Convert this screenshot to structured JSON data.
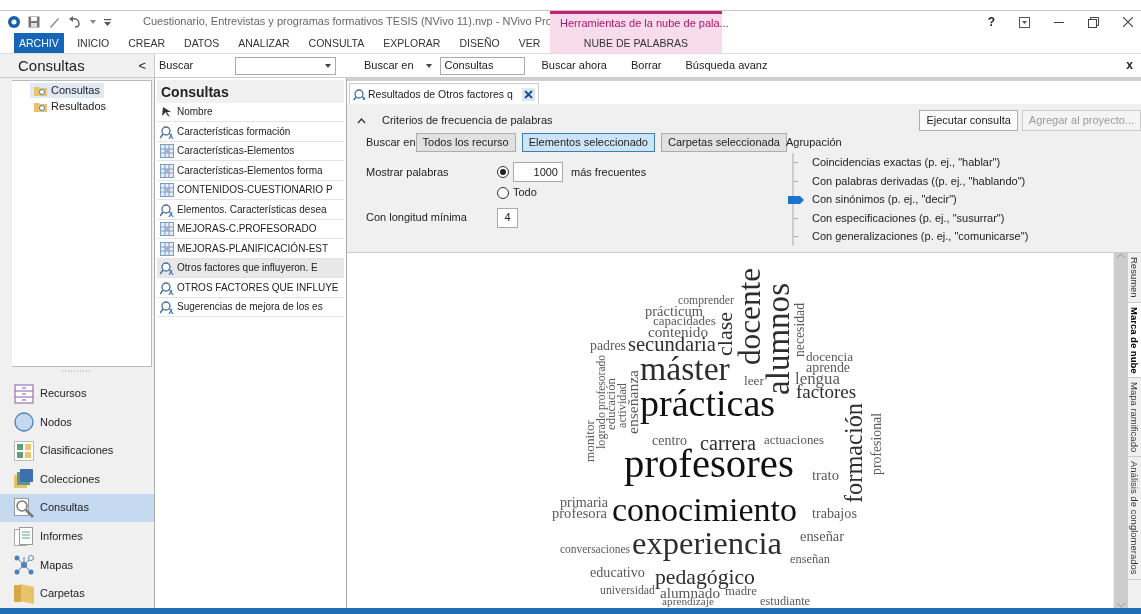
{
  "title_bar": {
    "title": "Cuestionario, Entrevistas y programas formativos TESIS (NVivo 11).nvp - NVivo Pro",
    "context_group": "Herramientas de la nube de pala...",
    "help": "?"
  },
  "ribbon_tabs": [
    {
      "label": "ARCHIV",
      "kind": "file"
    },
    {
      "label": "INICIO",
      "kind": "tab"
    },
    {
      "label": "CREAR",
      "kind": "tab"
    },
    {
      "label": "DATOS",
      "kind": "tab"
    },
    {
      "label": "ANALIZAR",
      "kind": "tab"
    },
    {
      "label": "CONSULTA",
      "kind": "tab"
    },
    {
      "label": "EXPLORAR",
      "kind": "tab"
    },
    {
      "label": "DISEÑO",
      "kind": "tab"
    },
    {
      "label": "VER",
      "kind": "tab"
    },
    {
      "label": "NUBE DE PALABRAS",
      "kind": "contextual"
    }
  ],
  "find_bar": {
    "pane_title": "Consultas",
    "collapse": "<",
    "find_label": "Buscar",
    "search_in_label": "Buscar en",
    "search_in_value": "Consultas",
    "buttons": [
      "Buscar ahora",
      "Borrar",
      "Búsqueda avanz"
    ],
    "close": "x"
  },
  "navigation": {
    "tree": [
      {
        "label": "Consultas",
        "selected": true
      },
      {
        "label": "Resultados",
        "selected": false
      }
    ],
    "sections": [
      {
        "label": "Recursos",
        "kind": "drawer",
        "selected": false
      },
      {
        "label": "Nodos",
        "kind": "circle",
        "selected": false
      },
      {
        "label": "Clasificaciones",
        "kind": "tiles",
        "selected": false
      },
      {
        "label": "Colecciones",
        "kind": "stack",
        "selected": false
      },
      {
        "label": "Consultas",
        "kind": "magnifier",
        "selected": true
      },
      {
        "label": "Informes",
        "kind": "document",
        "selected": false
      },
      {
        "label": "Mapas",
        "kind": "network",
        "selected": false
      },
      {
        "label": "Carpetas",
        "kind": "folder",
        "selected": false
      }
    ]
  },
  "list": {
    "title": "Consultas",
    "column": "Nombre",
    "rows": [
      {
        "name": "Características formación",
        "kind": "text",
        "selected": false
      },
      {
        "name": "Características-Elementos",
        "kind": "matrix",
        "selected": false
      },
      {
        "name": "Características-Elementos forma",
        "kind": "matrix",
        "selected": false
      },
      {
        "name": "CONTENIDOS-CUESTIONARIO P",
        "kind": "matrix",
        "selected": false
      },
      {
        "name": "Elementos. Características desea",
        "kind": "text",
        "selected": false
      },
      {
        "name": "MEJORAS-C.PROFESORADO",
        "kind": "matrix",
        "selected": false
      },
      {
        "name": "MEJORAS-PLANIFICACIÓN-EST",
        "kind": "matrix",
        "selected": false
      },
      {
        "name": "Otros factores que influyeron. E",
        "kind": "text",
        "selected": true
      },
      {
        "name": "OTROS FACTORES QUE INFLUYE",
        "kind": "text",
        "selected": false
      },
      {
        "name": "Sugerencias de mejora de los es",
        "kind": "text",
        "selected": false
      }
    ]
  },
  "document_tab": {
    "label": "Resultados de Otros factores q"
  },
  "criteria": {
    "title": "Criterios de frecuencia de palabras",
    "run_button": "Ejecutar consulta",
    "add_button": {
      "label": "Agregar al proyecto...",
      "disabled": true
    },
    "search_in_label": "Buscar en",
    "scope_buttons": [
      {
        "label": "Todos  los recurso",
        "selected": false
      },
      {
        "label": "Elementos seleccionado",
        "selected": true
      },
      {
        "label": "Carpetas seleccionada",
        "selected": false
      }
    ],
    "show_words_label": "Mostrar palabras",
    "top_count": {
      "selected": true,
      "value": "1000",
      "suffix": "más frecuentes"
    },
    "all_option": {
      "label": "Todo",
      "selected": false
    },
    "min_length_label": "Con longitud mínima",
    "min_length": "4",
    "grouping_label": "Agrupación",
    "grouping": [
      {
        "label": "Coincidencias exactas (p. ej., \"hablar\")",
        "selected": false
      },
      {
        "label": "Con palabras derivadas ((p. ej., \"hablando\")",
        "selected": false
      },
      {
        "label": "Con sinónimos (p. ej., \"decir\")",
        "selected": true
      },
      {
        "label": "Con especificaciones (p. ej., \"susurrar\")",
        "selected": false
      },
      {
        "label": "Con generalizaciones (p. ej., \"comunicarse\")",
        "selected": false
      }
    ]
  },
  "word_cloud": {
    "words": [
      {
        "text": "docente",
        "kind": "vertical"
      },
      {
        "text": "alumnos",
        "kind": "vertical"
      },
      {
        "text": "comprender",
        "kind": "horizontal"
      },
      {
        "text": "necesidad",
        "kind": "vertical"
      },
      {
        "text": "prácticum",
        "kind": "horizontal"
      },
      {
        "text": "clase",
        "kind": "vertical"
      },
      {
        "text": "capacidades",
        "kind": "horizontal"
      },
      {
        "text": "contenido",
        "kind": "horizontal"
      },
      {
        "text": "padres",
        "kind": "horizontal"
      },
      {
        "text": "secundaria",
        "kind": "horizontal"
      },
      {
        "text": "docencia",
        "kind": "horizontal"
      },
      {
        "text": "profesorado",
        "kind": "vertical"
      },
      {
        "text": "máster",
        "kind": "horizontal"
      },
      {
        "text": "aprende",
        "kind": "horizontal"
      },
      {
        "text": "enseñanza",
        "kind": "vertical"
      },
      {
        "text": "leer",
        "kind": "horizontal"
      },
      {
        "text": "lengua",
        "kind": "horizontal"
      },
      {
        "text": "educación",
        "kind": "vertical"
      },
      {
        "text": "actividad",
        "kind": "vertical"
      },
      {
        "text": "prácticas",
        "kind": "horizontal"
      },
      {
        "text": "factores",
        "kind": "horizontal"
      },
      {
        "text": "formación",
        "kind": "vertical"
      },
      {
        "text": "logrado",
        "kind": "vertical"
      },
      {
        "text": "profesional",
        "kind": "vertical"
      },
      {
        "text": "monitor",
        "kind": "vertical"
      },
      {
        "text": "centro",
        "kind": "horizontal"
      },
      {
        "text": "carrera",
        "kind": "horizontal"
      },
      {
        "text": "actuaciones",
        "kind": "horizontal"
      },
      {
        "text": "profesores",
        "kind": "horizontal"
      },
      {
        "text": "trato",
        "kind": "horizontal"
      },
      {
        "text": "primaria",
        "kind": "horizontal"
      },
      {
        "text": "profesora",
        "kind": "horizontal"
      },
      {
        "text": "conocimiento",
        "kind": "horizontal"
      },
      {
        "text": "trabajos",
        "kind": "horizontal"
      },
      {
        "text": "experiencia",
        "kind": "horizontal"
      },
      {
        "text": "enseñar",
        "kind": "horizontal"
      },
      {
        "text": "conversaciones",
        "kind": "horizontal"
      },
      {
        "text": "enseñan",
        "kind": "horizontal"
      },
      {
        "text": "educativo",
        "kind": "horizontal"
      },
      {
        "text": "pedagógico",
        "kind": "horizontal"
      },
      {
        "text": "universidad",
        "kind": "horizontal"
      },
      {
        "text": "alumnado",
        "kind": "horizontal"
      },
      {
        "text": "madre",
        "kind": "horizontal"
      },
      {
        "text": "aprendizaje",
        "kind": "horizontal"
      },
      {
        "text": "estudiante",
        "kind": "horizontal"
      }
    ]
  },
  "side_tabs": [
    {
      "label": "Resumen",
      "selected": false
    },
    {
      "label": "Marca de nube",
      "selected": true
    },
    {
      "label": "Mapa ramificado",
      "selected": false
    },
    {
      "label": "Análisis de conglomerados",
      "selected": false
    }
  ]
}
